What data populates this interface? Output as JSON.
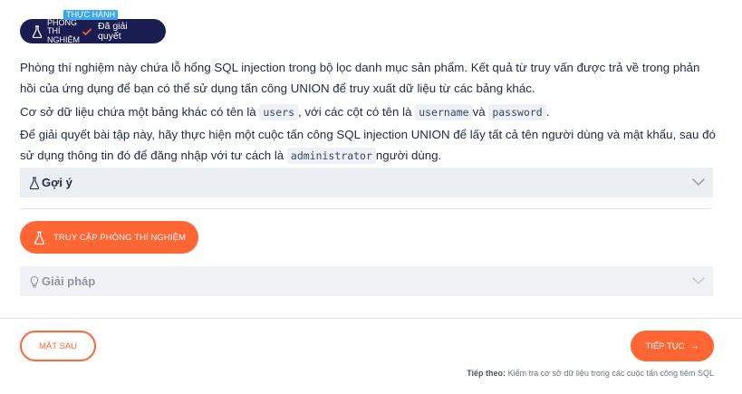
{
  "badge": {
    "tag": "THỰC HÀNH",
    "type": "PHÒNG THÍ NGHIỆM",
    "status": "Đã giải quyết",
    "icon": "flask-icon",
    "status_icon": "check-icon"
  },
  "content": {
    "p1": "Phòng thí nghiệm này chứa lỗ hổng SQL injection trong bộ lọc danh mục sản phẩm. Kết quả từ truy vấn được trả về trong phản hồi của ứng dụng để bạn có thể sử dụng tấn công UNION để truy xuất dữ liệu từ các bảng khác.",
    "p2_a": "Cơ sở dữ liệu chứa một bảng khác có tên là ",
    "p2_code1": "users",
    "p2_b": ", với các cột có tên là ",
    "p2_code2": "username",
    "p2_c": "và ",
    "p2_code3": "password",
    "p2_d": ".",
    "p3_a": "Để giải quyết bài tập này, hãy thực hiện một cuộc tấn công SQL injection UNION để lấy tất cả tên người dùng và mật khẩu, sau đó sử dụng thông tin đó để đăng nhập với tư cách là ",
    "p3_code": "administrator",
    "p3_b": "người dùng."
  },
  "hint": {
    "label": "Gợi ý",
    "icon": "flask-icon"
  },
  "access_button": {
    "label": "TRUY CẬP PHÒNG THÍ NGHIỆM",
    "icon": "flask-icon"
  },
  "solution": {
    "label": "Giải pháp",
    "icon": "lightbulb-icon"
  },
  "footer": {
    "back_label": "MẶT SAU",
    "next_label": "TIẾP TỤC",
    "next_arrow": "→",
    "next_prefix": "Tiếp theo:",
    "next_title": "Kiểm tra cơ sở dữ liệu trong các cuộc tấn công tiêm SQL"
  },
  "colors": {
    "accent": "#ff6633",
    "navy": "#1a1d4f",
    "tag": "#3aa7ee"
  }
}
